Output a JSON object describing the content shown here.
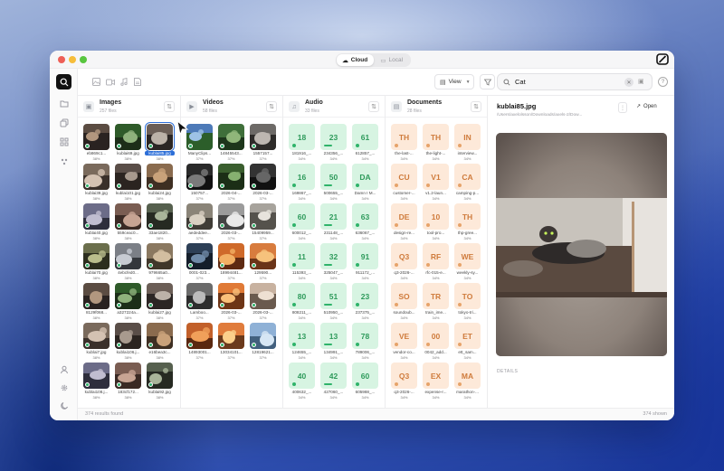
{
  "window": {
    "mode_tabs": [
      "Cloud",
      "Local"
    ],
    "active_mode": "Cloud"
  },
  "toolbar": {
    "view_label": "View",
    "search_value": "Cat"
  },
  "columns": {
    "images": {
      "title": "Images",
      "count": "257 files",
      "items": [
        {
          "name": "eb869c1...",
          "score": "38%"
        },
        {
          "name": "kublai69.jpg",
          "score": "38%"
        },
        {
          "name": "kublai85.jpg",
          "score": "38%",
          "selected": true
        },
        {
          "name": "kublai39.jpg",
          "score": "38%"
        },
        {
          "name": "kublai101.jpg",
          "score": "38%"
        },
        {
          "name": "kublai24.jpg",
          "score": "38%"
        },
        {
          "name": "kublai40.jpg",
          "score": "38%"
        },
        {
          "name": "559ceac0...",
          "score": "38%"
        },
        {
          "name": "33ae1820...",
          "score": "38%"
        },
        {
          "name": "kublai70.jpg",
          "score": "38%"
        },
        {
          "name": "4ebcfed0...",
          "score": "38%"
        },
        {
          "name": "979665a0...",
          "score": "38%"
        },
        {
          "name": "8129f068...",
          "score": "38%"
        },
        {
          "name": "a327224a...",
          "score": "38%"
        },
        {
          "name": "kublai27.jpg",
          "score": "38%"
        },
        {
          "name": "kublai7.jpg",
          "score": "38%"
        },
        {
          "name": "kublai106.j...",
          "score": "38%"
        },
        {
          "name": "e16bea3c...",
          "score": "38%"
        },
        {
          "name": "kublai108.j...",
          "score": "38%"
        },
        {
          "name": "183cf172...",
          "score": "38%"
        },
        {
          "name": "kublai92.jpg",
          "score": "38%"
        }
      ]
    },
    "videos": {
      "title": "Videos",
      "count": "58 files",
      "items": [
        {
          "name": "ManyClips...",
          "score": "37%"
        },
        {
          "name": "14845543...",
          "score": "37%"
        },
        {
          "name": "1557157...",
          "score": "37%"
        },
        {
          "name": "150757...",
          "score": "37%"
        },
        {
          "name": "2026-04-...",
          "score": "37%"
        },
        {
          "name": "2026-03-...",
          "score": "37%"
        },
        {
          "name": "aededdee...",
          "score": "37%"
        },
        {
          "name": "2026-03-...",
          "score": "37%"
        },
        {
          "name": "15409959...",
          "score": "37%"
        },
        {
          "name": "0001-023...",
          "score": "37%"
        },
        {
          "name": "18994481...",
          "score": "37%"
        },
        {
          "name": "129590...",
          "score": "37%"
        },
        {
          "name": "Lamboo...",
          "score": "37%"
        },
        {
          "name": "2026-03-...",
          "score": "37%"
        },
        {
          "name": "2026-03-...",
          "score": "37%"
        },
        {
          "name": "14893001...",
          "score": "37%"
        },
        {
          "name": "13034101...",
          "score": "37%"
        },
        {
          "name": "12819621...",
          "score": "37%"
        }
      ]
    },
    "audio": {
      "title": "Audio",
      "count": "33 files",
      "items": [
        {
          "badge": "18",
          "name": "181916_...",
          "score": "34%"
        },
        {
          "badge": "23",
          "name": "234356_...",
          "score": "34%"
        },
        {
          "badge": "61",
          "name": "612857_...",
          "score": "34%"
        },
        {
          "badge": "16",
          "name": "169867_...",
          "score": "34%"
        },
        {
          "badge": "50",
          "name": "500655_...",
          "score": "34%"
        },
        {
          "badge": "DA",
          "name": "Damn I M...",
          "score": "34%"
        },
        {
          "badge": "60",
          "name": "600012_...",
          "score": "34%"
        },
        {
          "badge": "21",
          "name": "231148_...",
          "score": "34%"
        },
        {
          "badge": "63",
          "name": "636067_...",
          "score": "34%"
        },
        {
          "badge": "11",
          "name": "115393_...",
          "score": "34%"
        },
        {
          "badge": "32",
          "name": "325047_...",
          "score": "34%"
        },
        {
          "badge": "91",
          "name": "911172_...",
          "score": "34%"
        },
        {
          "badge": "80",
          "name": "808211_...",
          "score": "34%"
        },
        {
          "badge": "51",
          "name": "510950_...",
          "score": "34%"
        },
        {
          "badge": "23",
          "name": "237375_...",
          "score": "34%"
        },
        {
          "badge": "13",
          "name": "124655_...",
          "score": "34%"
        },
        {
          "badge": "13",
          "name": "134991_...",
          "score": "34%"
        },
        {
          "badge": "78",
          "name": "789006_...",
          "score": "34%"
        },
        {
          "badge": "40",
          "name": "400632_...",
          "score": "34%"
        },
        {
          "badge": "42",
          "name": "427060_...",
          "score": "34%"
        },
        {
          "badge": "60",
          "name": "605988_...",
          "score": "34%"
        }
      ]
    },
    "documents": {
      "title": "Documents",
      "count": "28 files",
      "items": [
        {
          "badge": "TH",
          "name": "the-last-...",
          "score": "34%"
        },
        {
          "badge": "TH",
          "name": "the-light-...",
          "score": "34%"
        },
        {
          "badge": "IN",
          "name": "interview...",
          "score": "34%"
        },
        {
          "badge": "CU",
          "name": "customer-...",
          "score": "34%"
        },
        {
          "badge": "V1",
          "name": "v1.2-laun...",
          "score": "34%"
        },
        {
          "badge": "CA",
          "name": "camping-p...",
          "score": "34%"
        },
        {
          "badge": "DE",
          "name": "design-re...",
          "score": "34%"
        },
        {
          "badge": "10",
          "name": "tool-pro...",
          "score": "34%"
        },
        {
          "badge": "TH",
          "name": "thp-gree...",
          "score": "34%"
        },
        {
          "badge": "Q3",
          "name": "q3-2026-...",
          "score": "34%"
        },
        {
          "badge": "RF",
          "name": "rfc-015-e...",
          "score": "34%"
        },
        {
          "badge": "WE",
          "name": "weekly-sy...",
          "score": "34%"
        },
        {
          "badge": "SO",
          "name": "soundoub...",
          "score": "34%"
        },
        {
          "badge": "TR",
          "name": "train_ime...",
          "score": "34%"
        },
        {
          "badge": "TO",
          "name": "tokyo-tri...",
          "score": "34%"
        },
        {
          "badge": "VE",
          "name": "vendor-co...",
          "score": "34%"
        },
        {
          "badge": "00",
          "name": "0042_add...",
          "score": "34%"
        },
        {
          "badge": "ET",
          "name": "ett_sam...",
          "score": "34%"
        },
        {
          "badge": "Q3",
          "name": "q3-2026-...",
          "score": "34%"
        },
        {
          "badge": "EX",
          "name": "expense-r...",
          "score": "34%"
        },
        {
          "badge": "MA",
          "name": "marathon-...",
          "score": "34%"
        }
      ]
    }
  },
  "preview": {
    "filename": "kublai85.jpg",
    "path": "/Users/axelolsson/Downloads/axels-2/Dow...",
    "open_label": "Open",
    "details_label": "DETAILS"
  },
  "status": {
    "left": "374 results found",
    "right": "374 shown"
  }
}
